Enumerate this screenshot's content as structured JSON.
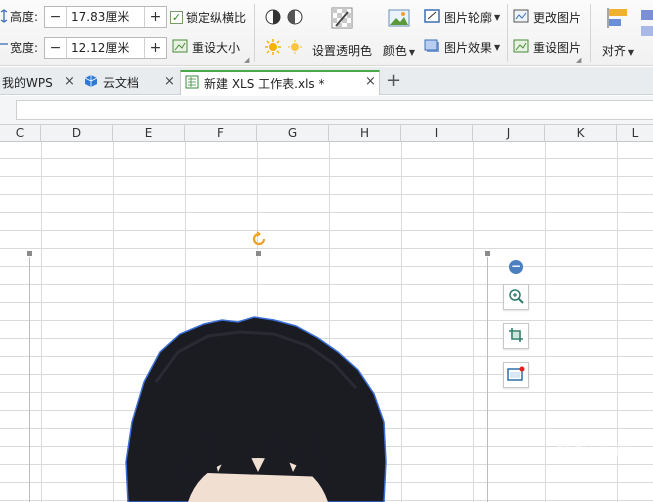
{
  "ribbon": {
    "height_label": "高度:",
    "height_value": "17.83厘米",
    "width_label": "宽度:",
    "width_value": "12.12厘米",
    "lock_ratio_label": "锁定纵横比",
    "lock_ratio_checked": true,
    "reset_size_label": "重设大小",
    "set_transparent_label": "设置透明色",
    "color_label": "颜色",
    "picture_outline_label": "图片轮廓",
    "picture_effect_label": "图片效果",
    "change_picture_label": "更改图片",
    "reset_picture_label": "重设图片",
    "align_label": "对齐",
    "minus": "−",
    "plus": "+"
  },
  "tabs": [
    {
      "label": "我的WPS",
      "close": "×"
    },
    {
      "label": "云文档",
      "close": "×"
    },
    {
      "label": "新建 XLS 工作表.xls *",
      "close": "×",
      "active": true
    }
  ],
  "new_tab": "+",
  "columns": [
    "C",
    "D",
    "E",
    "F",
    "G",
    "H",
    "I",
    "J",
    "K",
    "L"
  ],
  "watermark": "Shaiwiki",
  "colors": {
    "accent_green": "#4aa84a",
    "grid_line": "#dadada",
    "handle_blue": "#4a7fc0",
    "hair": "#1b1b22"
  },
  "icons": {
    "rotate_handle": "rotate-icon",
    "zoom": "zoom-in-icon",
    "crop": "crop-icon",
    "frame": "picture-frame-icon"
  }
}
